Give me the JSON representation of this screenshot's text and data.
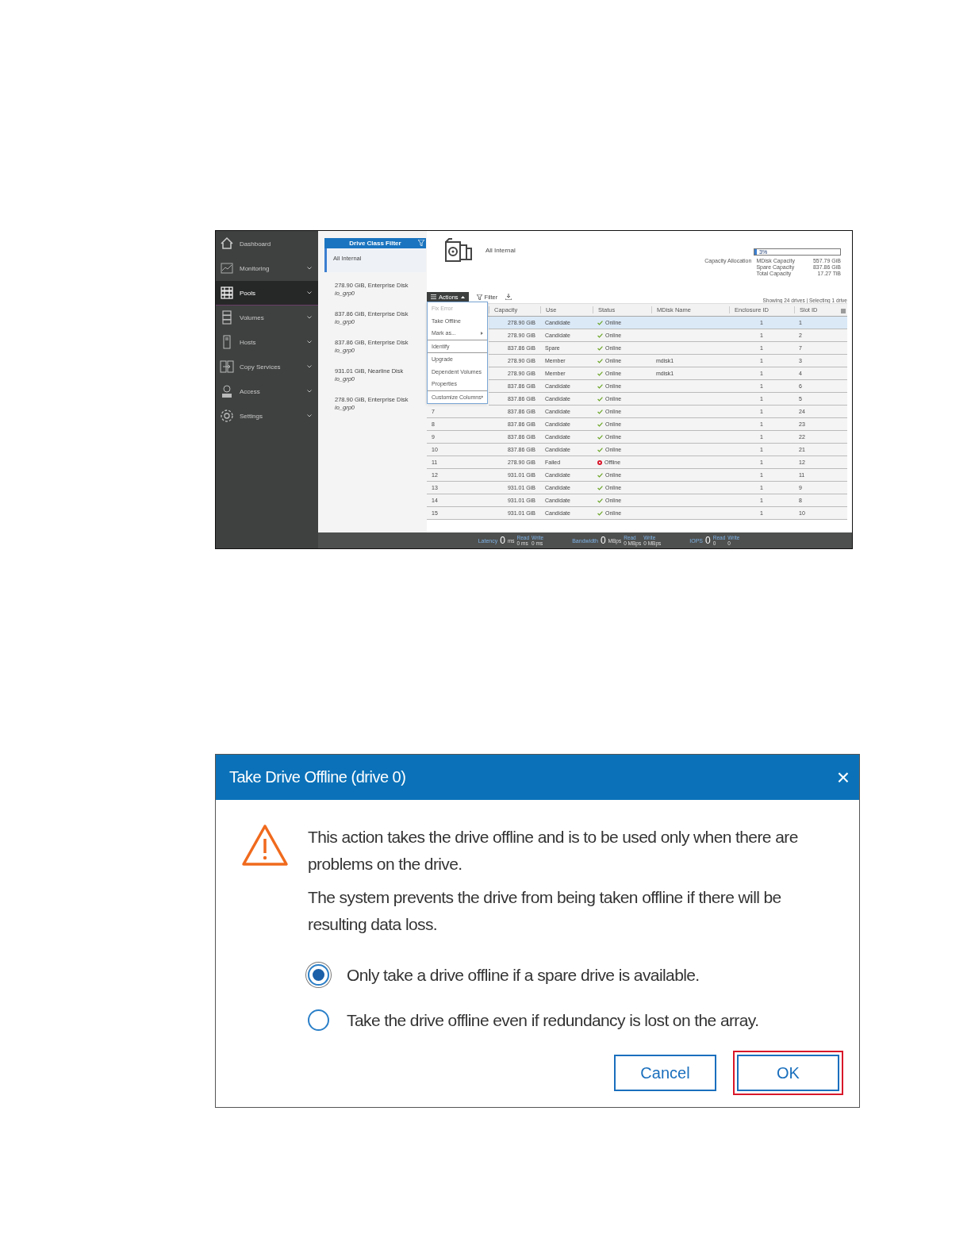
{
  "sidebar": {
    "items": [
      {
        "label": "Dashboard",
        "selected": false,
        "expandable": false
      },
      {
        "label": "Monitoring",
        "selected": false,
        "expandable": true
      },
      {
        "label": "Pools",
        "selected": true,
        "expandable": true
      },
      {
        "label": "Volumes",
        "selected": false,
        "expandable": true
      },
      {
        "label": "Hosts",
        "selected": false,
        "expandable": true
      },
      {
        "label": "Copy Services",
        "selected": false,
        "expandable": true
      },
      {
        "label": "Access",
        "selected": false,
        "expandable": true
      },
      {
        "label": "Settings",
        "selected": false,
        "expandable": true
      }
    ]
  },
  "drive_class_filter": {
    "title": "Drive Class Filter",
    "items": [
      {
        "label": "All Internal",
        "selected": true
      },
      {
        "label": "278.90 GiB, Enterprise Disk",
        "group": "io_grp0",
        "selected": false
      },
      {
        "label": "837.86 GiB, Enterprise Disk",
        "group": "io_grp0",
        "selected": false
      },
      {
        "label": "837.86 GiB, Enterprise Disk",
        "group": "io_grp0",
        "selected": false
      },
      {
        "label": "931.01 GiB, Nearline Disk",
        "group": "io_grp0",
        "selected": false
      },
      {
        "label": "278.90 GiB, Enterprise Disk",
        "group": "io_grp0",
        "selected": false
      }
    ]
  },
  "header": {
    "title": "All Internal",
    "capacity": {
      "label": "Capacity Allocation",
      "percent": "3%",
      "level": 0.03,
      "rows": [
        {
          "name": "MDisk Capacity",
          "value": "557.79 GiB"
        },
        {
          "name": "Spare Capacity",
          "value": "837.86 GiB"
        },
        {
          "name": "Total Capacity",
          "value": "17.27 TiB"
        }
      ]
    }
  },
  "toolbar": {
    "actions": "Actions",
    "filter": "Filter",
    "summary": "Showing 24 drives | Selecting 1 drive"
  },
  "actions_menu": {
    "sections": [
      [
        {
          "label": "Fix Error",
          "disabled": true,
          "submenu": false
        },
        {
          "label": "Take Offline",
          "disabled": false,
          "submenu": false
        },
        {
          "label": "Mark as...",
          "disabled": false,
          "submenu": true
        }
      ],
      [
        {
          "label": "Identify",
          "disabled": false,
          "submenu": false
        }
      ],
      [
        {
          "label": "Upgrade",
          "disabled": false,
          "submenu": false
        },
        {
          "label": "Dependent Volumes",
          "disabled": false,
          "submenu": false
        },
        {
          "label": "Properties",
          "disabled": false,
          "submenu": false
        }
      ],
      [
        {
          "label": "Customize Columns",
          "disabled": false,
          "submenu": true
        }
      ]
    ]
  },
  "table": {
    "columns": [
      "Capacity",
      "Use",
      "Status",
      "MDisk Name",
      "Enclosure ID",
      "Slot ID"
    ],
    "rows": [
      {
        "capacity": "278.90 GiB",
        "use": "Candidate",
        "status": "Online",
        "kind": "online",
        "enclosure": "1",
        "slot": "1",
        "selected": true
      },
      {
        "capacity": "278.90 GiB",
        "use": "Candidate",
        "status": "Online",
        "kind": "online",
        "enclosure": "1",
        "slot": "2",
        "selected": false
      },
      {
        "capacity": "837.86 GiB",
        "use": "Spare",
        "status": "Online",
        "kind": "online",
        "enclosure": "1",
        "slot": "7",
        "selected": false
      },
      {
        "capacity": "278.90 GiB",
        "use": "Member",
        "status": "Online",
        "kind": "online",
        "mdisk": "mdisk1",
        "enclosure": "1",
        "slot": "3",
        "selected": false
      },
      {
        "capacity": "278.90 GiB",
        "use": "Member",
        "status": "Online",
        "kind": "online",
        "mdisk": "mdisk1",
        "enclosure": "1",
        "slot": "4",
        "selected": false
      },
      {
        "capacity": "837.86 GiB",
        "use": "Candidate",
        "status": "Online",
        "kind": "online",
        "enclosure": "1",
        "slot": "6",
        "selected": false
      },
      {
        "capacity": "837.86 GiB",
        "use": "Candidate",
        "status": "Online",
        "kind": "online",
        "enclosure": "1",
        "slot": "5",
        "selected": false
      },
      {
        "id": "7",
        "capacity": "837.86 GiB",
        "use": "Candidate",
        "status": "Online",
        "kind": "online",
        "enclosure": "1",
        "slot": "24",
        "selected": false
      },
      {
        "id": "8",
        "capacity": "837.86 GiB",
        "use": "Candidate",
        "status": "Online",
        "kind": "online",
        "enclosure": "1",
        "slot": "23",
        "selected": false
      },
      {
        "id": "9",
        "capacity": "837.86 GiB",
        "use": "Candidate",
        "status": "Online",
        "kind": "online",
        "enclosure": "1",
        "slot": "22",
        "selected": false
      },
      {
        "id": "10",
        "capacity": "837.86 GiB",
        "use": "Candidate",
        "status": "Online",
        "kind": "online",
        "enclosure": "1",
        "slot": "21",
        "selected": false
      },
      {
        "id": "11",
        "capacity": "278.90 GiB",
        "use": "Failed",
        "status": "Offline",
        "kind": "offline",
        "enclosure": "1",
        "slot": "12",
        "selected": false
      },
      {
        "id": "12",
        "capacity": "931.01 GiB",
        "use": "Candidate",
        "status": "Online",
        "kind": "online",
        "enclosure": "1",
        "slot": "11",
        "selected": false
      },
      {
        "id": "13",
        "capacity": "931.01 GiB",
        "use": "Candidate",
        "status": "Online",
        "kind": "online",
        "enclosure": "1",
        "slot": "9",
        "selected": false
      },
      {
        "id": "14",
        "capacity": "931.01 GiB",
        "use": "Candidate",
        "status": "Online",
        "kind": "online",
        "enclosure": "1",
        "slot": "8",
        "selected": false
      },
      {
        "id": "15",
        "capacity": "931.01 GiB",
        "use": "Candidate",
        "status": "Online",
        "kind": "online",
        "enclosure": "1",
        "slot": "10",
        "selected": false
      }
    ]
  },
  "status_bar": [
    {
      "label": "Latency",
      "value": "0",
      "unit": "ms",
      "read_label": "Read",
      "read": "0 ms",
      "write_label": "Write",
      "write": "0 ms"
    },
    {
      "label": "Bandwidth",
      "value": "0",
      "unit": "MBps",
      "read_label": "Read",
      "read": "0 MBps",
      "write_label": "Write",
      "write": "0 MBps"
    },
    {
      "label": "IOPS",
      "value": "0",
      "read_label": "Read",
      "read": "0",
      "write_label": "Write",
      "write": "0"
    }
  ],
  "dialog": {
    "title": "Take Drive Offline (drive 0)",
    "close": "×",
    "paragraphs": [
      "This action takes the drive offline and is to be used only when there are problems on the drive.",
      "The system prevents the drive from being taken offline if there will be resulting data loss."
    ],
    "options": [
      {
        "label": "Only take a drive offline if a spare drive is available.",
        "selected": true
      },
      {
        "label": "Take the drive offline even if redundancy is lost on the array.",
        "selected": false
      }
    ],
    "buttons": [
      {
        "label": "Cancel",
        "highlighted": false
      },
      {
        "label": "OK",
        "highlighted": true
      }
    ]
  }
}
